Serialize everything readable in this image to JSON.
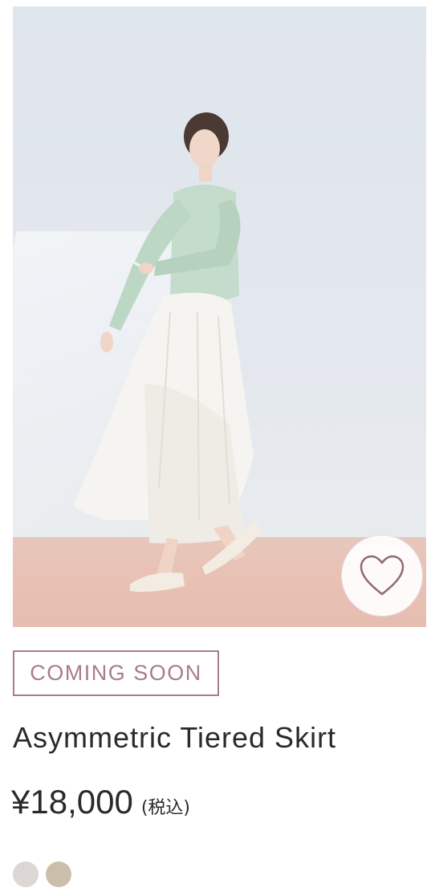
{
  "product": {
    "image_alt": "Model wearing a mint ribbed cardigan and white asymmetric tiered skirt",
    "status_badge": "COMING SOON",
    "title": "Asymmetric Tiered Skirt",
    "price": "¥18,000",
    "tax_note": "(税込)",
    "favorite_icon": "heart-icon"
  },
  "swatches": [
    {
      "name": "color-swatch-ivory",
      "color": "#dcd6d5"
    },
    {
      "name": "color-swatch-beige",
      "color": "#cbbfab"
    }
  ],
  "colors": {
    "accent": "#a97d88",
    "text": "#2a2a2a",
    "heart_stroke": "#8c6a73"
  }
}
